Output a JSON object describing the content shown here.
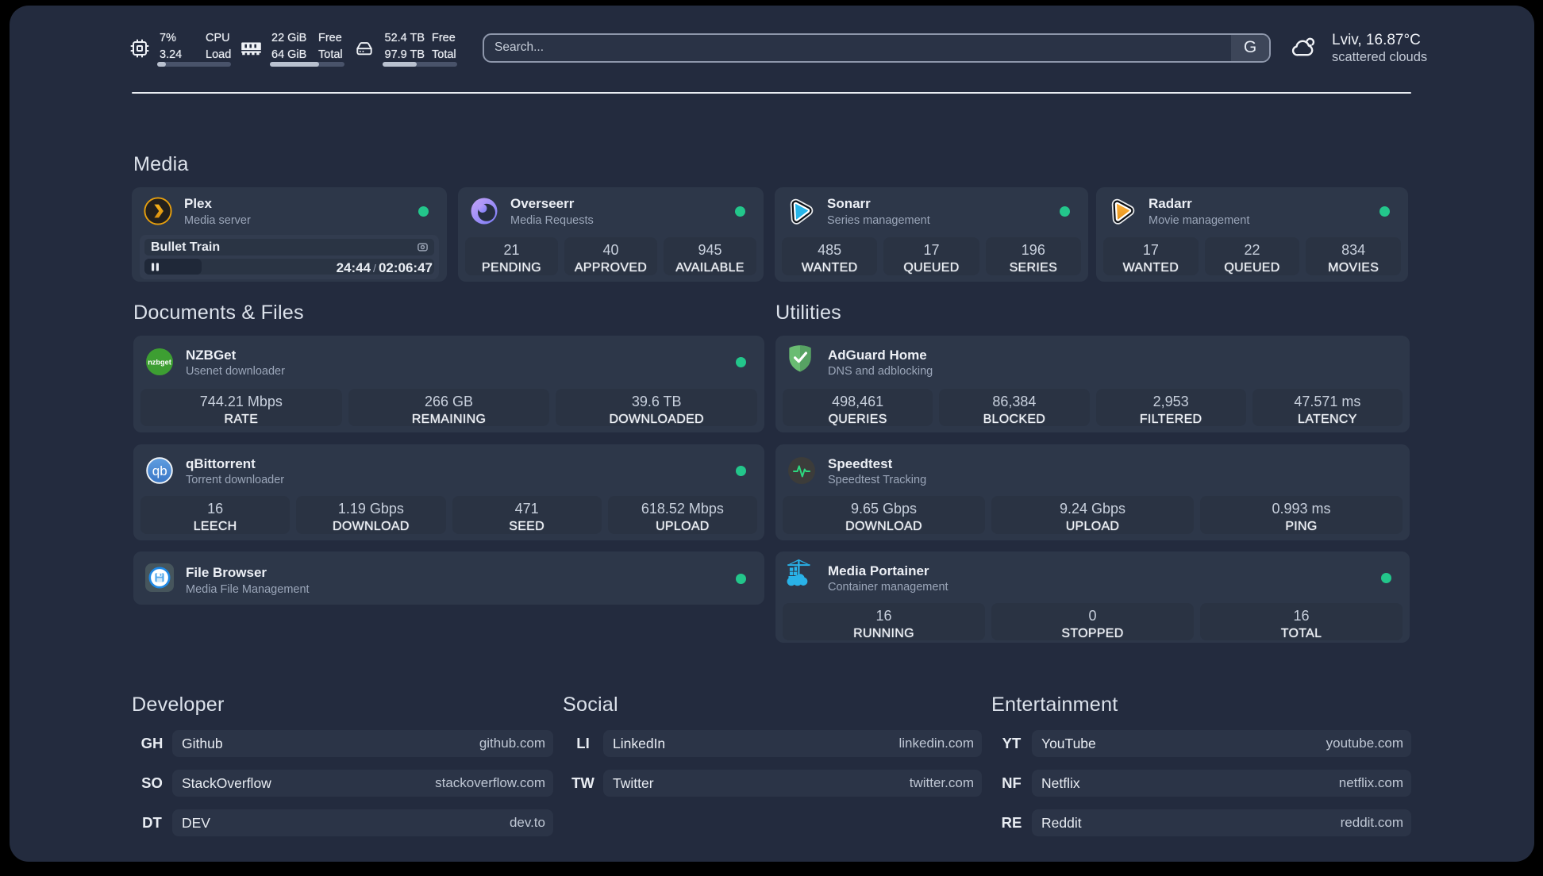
{
  "topbar": {
    "resources": [
      {
        "icon": "cpu-icon",
        "value1": "7%",
        "value2": "3.24",
        "label1": "CPU",
        "label2": "Load",
        "progress_pct": 7
      },
      {
        "icon": "memory-icon",
        "value1": "22 GiB",
        "value2": "64 GiB",
        "label1": "Free",
        "label2": "Total",
        "progress_pct": 65.6
      },
      {
        "icon": "disk-icon",
        "value1": "52.4 TB",
        "value2": "97.9 TB",
        "label1": "Free",
        "label2": "Total",
        "progress_pct": 46.5
      }
    ],
    "search": {
      "placeholder": "Search...",
      "button_label": "G"
    },
    "weather": {
      "location_temp": "Lviv, 16.87°C",
      "condition": "scattered clouds"
    }
  },
  "media": {
    "title": "Media",
    "services": [
      {
        "name": "Plex",
        "desc": "Media server",
        "logo": "plex",
        "online": true,
        "player": {
          "track": "Bullet Train",
          "elapsed": "24:44",
          "separator": "/",
          "total": "02:06:47",
          "progress_pct": 19.8
        }
      },
      {
        "name": "Overseerr",
        "desc": "Media Requests",
        "logo": "overseerr",
        "online": true,
        "stats": [
          {
            "value": "21",
            "label": "PENDING"
          },
          {
            "value": "40",
            "label": "APPROVED"
          },
          {
            "value": "945",
            "label": "AVAILABLE"
          }
        ]
      },
      {
        "name": "Sonarr",
        "desc": "Series management",
        "logo": "sonarr",
        "online": true,
        "stats": [
          {
            "value": "485",
            "label": "WANTED"
          },
          {
            "value": "17",
            "label": "QUEUED"
          },
          {
            "value": "196",
            "label": "SERIES"
          }
        ]
      },
      {
        "name": "Radarr",
        "desc": "Movie management",
        "logo": "radarr",
        "online": true,
        "stats": [
          {
            "value": "17",
            "label": "WANTED"
          },
          {
            "value": "22",
            "label": "QUEUED"
          },
          {
            "value": "834",
            "label": "MOVIES"
          }
        ]
      }
    ]
  },
  "documents": {
    "title": "Documents & Files",
    "services": [
      {
        "name": "NZBGet",
        "desc": "Usenet downloader",
        "logo": "nzbget",
        "logo_text": "nzbget",
        "online": true,
        "stats": [
          {
            "value": "744.21 Mbps",
            "label": "RATE"
          },
          {
            "value": "266 GB",
            "label": "REMAINING"
          },
          {
            "value": "39.6 TB",
            "label": "DOWNLOADED"
          }
        ]
      },
      {
        "name": "qBittorrent",
        "desc": "Torrent downloader",
        "logo": "qbittorrent",
        "logo_text": "qb",
        "online": true,
        "stats": [
          {
            "value": "16",
            "label": "LEECH"
          },
          {
            "value": "1.19 Gbps",
            "label": "DOWNLOAD"
          },
          {
            "value": "471",
            "label": "SEED"
          },
          {
            "value": "618.52 Mbps",
            "label": "UPLOAD"
          }
        ]
      },
      {
        "name": "File Browser",
        "desc": "Media File Management",
        "logo": "filebrowser",
        "online": true,
        "stats": []
      }
    ]
  },
  "utilities": {
    "title": "Utilities",
    "services": [
      {
        "name": "AdGuard Home",
        "desc": "DNS and adblocking",
        "logo": "adguard",
        "online": null,
        "stats": [
          {
            "value": "498,461",
            "label": "QUERIES"
          },
          {
            "value": "86,384",
            "label": "BLOCKED"
          },
          {
            "value": "2,953",
            "label": "FILTERED"
          },
          {
            "value": "47.571 ms",
            "label": "LATENCY"
          }
        ]
      },
      {
        "name": "Speedtest",
        "desc": "Speedtest Tracking",
        "logo": "speedtest",
        "online": null,
        "stats": [
          {
            "value": "9.65 Gbps",
            "label": "DOWNLOAD"
          },
          {
            "value": "9.24 Gbps",
            "label": "UPLOAD"
          },
          {
            "value": "0.993 ms",
            "label": "PING"
          }
        ]
      },
      {
        "name": "Media Portainer",
        "desc": "Container management",
        "logo": "portainer",
        "online": true,
        "stats": [
          {
            "value": "16",
            "label": "RUNNING"
          },
          {
            "value": "0",
            "label": "STOPPED"
          },
          {
            "value": "16",
            "label": "TOTAL"
          }
        ]
      }
    ]
  },
  "bookmarks": [
    {
      "title": "Developer",
      "items": [
        {
          "abbr": "GH",
          "name": "Github",
          "url": "github.com"
        },
        {
          "abbr": "SO",
          "name": "StackOverflow",
          "url": "stackoverflow.com"
        },
        {
          "abbr": "DT",
          "name": "DEV",
          "url": "dev.to"
        }
      ]
    },
    {
      "title": "Social",
      "items": [
        {
          "abbr": "LI",
          "name": "LinkedIn",
          "url": "linkedin.com"
        },
        {
          "abbr": "TW",
          "name": "Twitter",
          "url": "twitter.com"
        }
      ]
    },
    {
      "title": "Entertainment",
      "items": [
        {
          "abbr": "YT",
          "name": "YouTube",
          "url": "youtube.com"
        },
        {
          "abbr": "NF",
          "name": "Netflix",
          "url": "netflix.com"
        },
        {
          "abbr": "RE",
          "name": "Reddit",
          "url": "reddit.com"
        }
      ]
    }
  ],
  "colors": {
    "background": "#232b3e",
    "card": "#2d3749",
    "online_dot": "#23c68b",
    "accent_green": "#5aba5a",
    "accent_blue": "#29b8e8",
    "accent_orange": "#e5a00d",
    "accent_purple": "#8a7cf8",
    "accent_cyan": "#29b6f0"
  }
}
